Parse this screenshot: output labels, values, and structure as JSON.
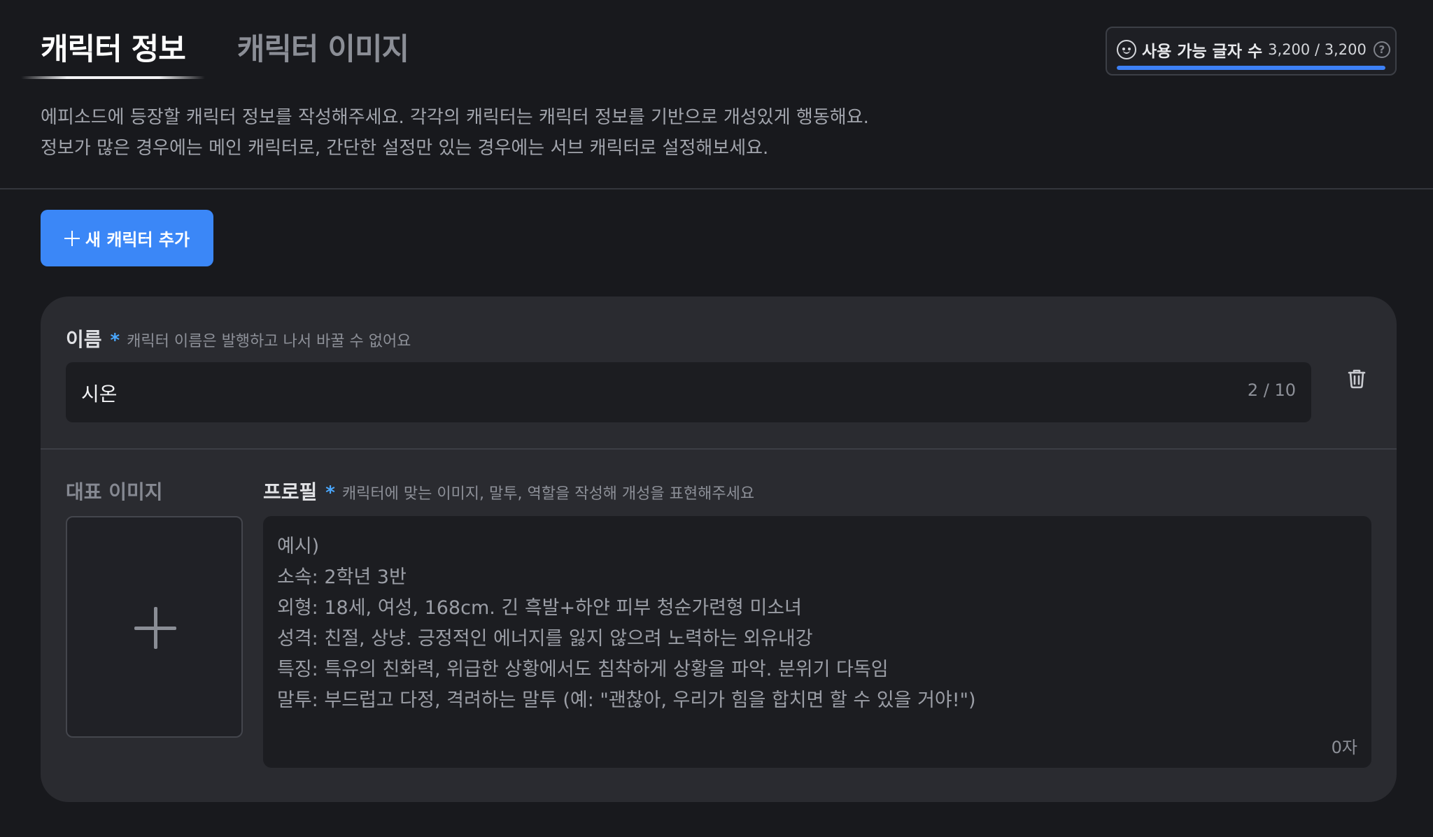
{
  "tabs": [
    {
      "label": "캐릭터 정보",
      "active": true
    },
    {
      "label": "캐릭터 이미지",
      "active": false
    }
  ],
  "char_counter": {
    "icon": "smiley-icon",
    "label": "사용 가능 글자 수",
    "value": "3,200 / 3,200",
    "help_icon": "?",
    "progress": 1.0,
    "bar_color": "#3d80f5"
  },
  "description": {
    "line1": "에피소드에 등장할 캐릭터 정보를 작성해주세요. 각각의 캐릭터는 캐릭터 정보를 기반으로 개성있게 행동해요.",
    "line2": "정보가 많은 경우에는 메인 캐릭터로, 간단한 설정만 있는 경우에는 서브 캐릭터로 설정해보세요."
  },
  "add_button": {
    "label": "새 캐릭터 추가",
    "icon": "plus-icon",
    "color": "#3b87f7"
  },
  "character_card": {
    "name_field": {
      "label": "이름",
      "required_mark": "*",
      "hint": "캐릭터 이름은 발행하고 나서 바꿀 수 없어요",
      "value": "시온",
      "counter": "2 / 10"
    },
    "delete_icon": "trash-icon",
    "image_field": {
      "label": "대표 이미지",
      "icon": "plus-icon"
    },
    "profile_field": {
      "label": "프로필",
      "required_mark": "*",
      "hint": "캐릭터에 맞는 이미지, 말투, 역할을 작성해 개성을 표현해주세요",
      "placeholder": "예시)\n소속: 2학년 3반\n외형: 18세, 여성, 168cm. 긴 흑발+하얀 피부 청순가련형 미소녀\n성격: 친절, 상냥. 긍정적인 에너지를 잃지 않으려 노력하는 외유내강\n특징: 특유의 친화력, 위급한 상황에서도 침착하게 상황을 파악. 분위기 다독임\n말투: 부드럽고 다정, 격려하는 말투 (예: \"괜찮아, 우리가 힘을 합치면 할 수 있을 거야!\")",
      "counter": "0자"
    }
  }
}
